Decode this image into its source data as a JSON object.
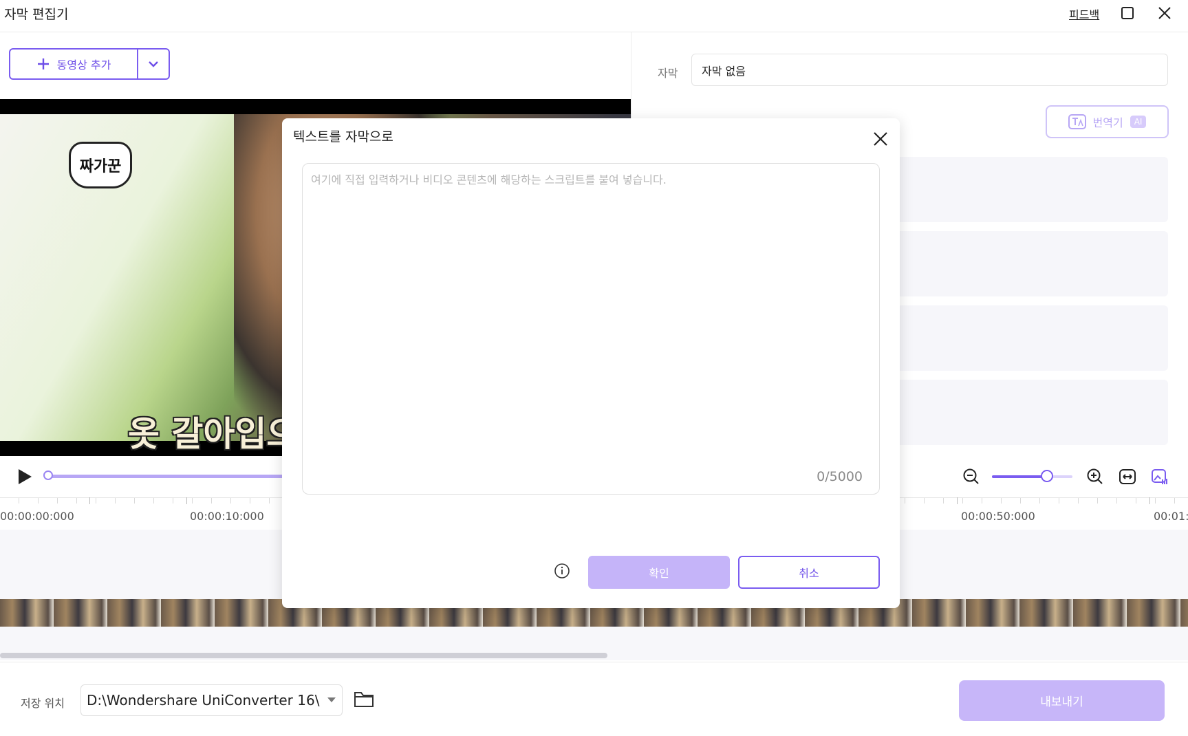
{
  "window": {
    "title": "자막 편집기",
    "feedback_label": "피드백"
  },
  "left_panel": {
    "add_video_label": "동영상 추가",
    "video_subtitle_text": "옷 갈아입으",
    "logo_text": "짜가꾼"
  },
  "right_panel": {
    "subtitle_label": "자막",
    "subtitle_value": "자막 없음",
    "translate_label": "번역기",
    "ai_badge": "AI"
  },
  "timeline": {
    "labels": [
      "00:00:00:000",
      "00:00:10:000",
      "00:00:50:000",
      "00:01:"
    ]
  },
  "bottom": {
    "save_location_label": "저장 위치",
    "save_path": "D:\\Wondershare UniConverter 16\\",
    "export_label": "내보내기"
  },
  "modal": {
    "title": "텍스트를 자막으로",
    "placeholder": "여기에 직접 입력하거나 비디오 콘텐츠에 해당하는 스크립트를 붙여 넣습니다.",
    "counter": "0/5000",
    "ok_label": "확인",
    "cancel_label": "취소"
  },
  "colors": {
    "accent": "#7a5cf0",
    "accent_light": "#c5b4f9"
  }
}
